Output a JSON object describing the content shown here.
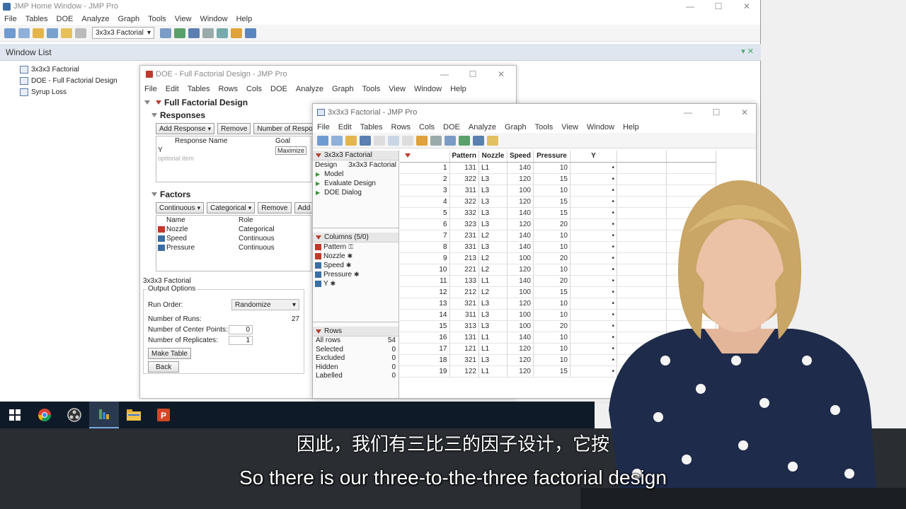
{
  "home": {
    "title": "JMP Home Window - JMP Pro",
    "menu": [
      "File",
      "Tables",
      "DOE",
      "Analyze",
      "Graph",
      "Tools",
      "View",
      "Window",
      "Help"
    ],
    "toolbar_select": "3x3x3 Factorial"
  },
  "window_list": {
    "title": "Window List",
    "items": [
      "3x3x3 Factorial",
      "DOE - Full Factorial Design",
      "Syrup Loss"
    ]
  },
  "doe": {
    "title": "DOE - Full Factorial Design - JMP Pro",
    "menu": [
      "File",
      "Edit",
      "Tables",
      "Rows",
      "Cols",
      "DOE",
      "Analyze",
      "Graph",
      "Tools",
      "View",
      "Window",
      "Help"
    ],
    "heading": "Full Factorial Design",
    "responses": {
      "title": "Responses",
      "buttons": [
        "Add Response",
        "Remove",
        "Number of Respon"
      ],
      "col_name": "Response Name",
      "col_goal": "Goal",
      "row_name": "Y",
      "row_goal": "Maximize",
      "optional": "optional item"
    },
    "factors": {
      "title": "Factors",
      "buttons": [
        "Continuous",
        "Categorical",
        "Remove",
        "Add N"
      ],
      "col_name": "Name",
      "col_role": "Role",
      "rows": [
        {
          "name": "Nozzle",
          "role": "Categorical"
        },
        {
          "name": "Speed",
          "role": "Continuous"
        },
        {
          "name": "Pressure",
          "role": "Continuous"
        }
      ]
    },
    "design_name": "3x3x3 Factorial",
    "output": {
      "title": "Output Options",
      "run_order_label": "Run Order:",
      "run_order_value": "Randomize",
      "runs_label": "Number of Runs:",
      "runs_value": "27",
      "center_label": "Number of Center Points:",
      "center_value": "0",
      "replicates_label": "Number of Replicates:",
      "replicates_value": "1",
      "make_table": "Make Table",
      "back": "Back"
    }
  },
  "table": {
    "title": "3x3x3 Factorial - JMP Pro",
    "menu": [
      "File",
      "Edit",
      "Tables",
      "Rows",
      "Cols",
      "DOE",
      "Analyze",
      "Graph",
      "Tools",
      "View",
      "Window",
      "Help"
    ],
    "panel_title": "3x3x3 Factorial",
    "design_label": "Design",
    "design_value": "3x3x3 Factorial",
    "scripts": [
      "Model",
      "Evaluate Design",
      "DOE Dialog"
    ],
    "columns_title": "Columns (5/0)",
    "columns": [
      "Pattern",
      "Nozzle",
      "Speed",
      "Pressure",
      "Y"
    ],
    "rows_title": "Rows",
    "row_stats": [
      {
        "label": "All rows",
        "value": "54"
      },
      {
        "label": "Selected",
        "value": "0"
      },
      {
        "label": "Excluded",
        "value": "0"
      },
      {
        "label": "Hidden",
        "value": "0"
      },
      {
        "label": "Labelled",
        "value": "0"
      }
    ],
    "headers": [
      "Pattern",
      "Nozzle",
      "Speed",
      "Pressure",
      "Y"
    ],
    "rows": [
      [
        "1",
        "131",
        "L1",
        "140",
        "10",
        "•"
      ],
      [
        "2",
        "322",
        "L3",
        "120",
        "15",
        "•"
      ],
      [
        "3",
        "311",
        "L3",
        "100",
        "10",
        "•"
      ],
      [
        "4",
        "322",
        "L3",
        "120",
        "15",
        "•"
      ],
      [
        "5",
        "332",
        "L3",
        "140",
        "15",
        "•"
      ],
      [
        "6",
        "323",
        "L3",
        "120",
        "20",
        "•"
      ],
      [
        "7",
        "231",
        "L2",
        "140",
        "10",
        "•"
      ],
      [
        "8",
        "331",
        "L3",
        "140",
        "10",
        "•"
      ],
      [
        "9",
        "213",
        "L2",
        "100",
        "20",
        "•"
      ],
      [
        "10",
        "221",
        "L2",
        "120",
        "10",
        "•"
      ],
      [
        "11",
        "133",
        "L1",
        "140",
        "20",
        "•"
      ],
      [
        "12",
        "212",
        "L2",
        "100",
        "15",
        "•"
      ],
      [
        "13",
        "321",
        "L3",
        "120",
        "10",
        "•"
      ],
      [
        "14",
        "311",
        "L3",
        "100",
        "10",
        "•"
      ],
      [
        "15",
        "313",
        "L3",
        "100",
        "20",
        "•"
      ],
      [
        "16",
        "131",
        "L1",
        "140",
        "10",
        "•"
      ],
      [
        "17",
        "121",
        "L1",
        "120",
        "10",
        "•"
      ],
      [
        "18",
        "321",
        "L3",
        "120",
        "10",
        "•"
      ],
      [
        "19",
        "122",
        "L1",
        "120",
        "15",
        "•"
      ]
    ]
  },
  "subtitles": {
    "cn": "因此，我们有三比三的因子设计，它按",
    "en": "So there is our three-to-the-three factorial design"
  }
}
